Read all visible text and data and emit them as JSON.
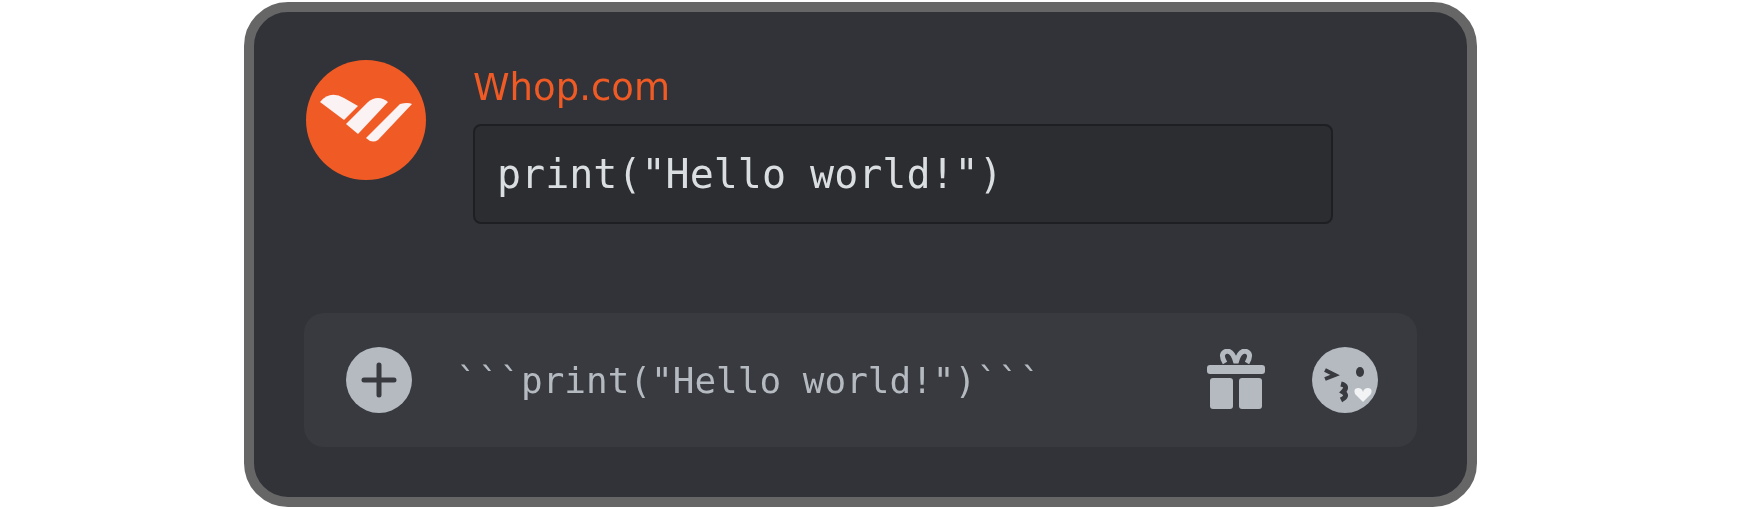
{
  "message": {
    "author": "Whop.com",
    "code": "print(\"Hello world!\")"
  },
  "composer": {
    "value": "```print(\"Hello world!\")```"
  }
}
